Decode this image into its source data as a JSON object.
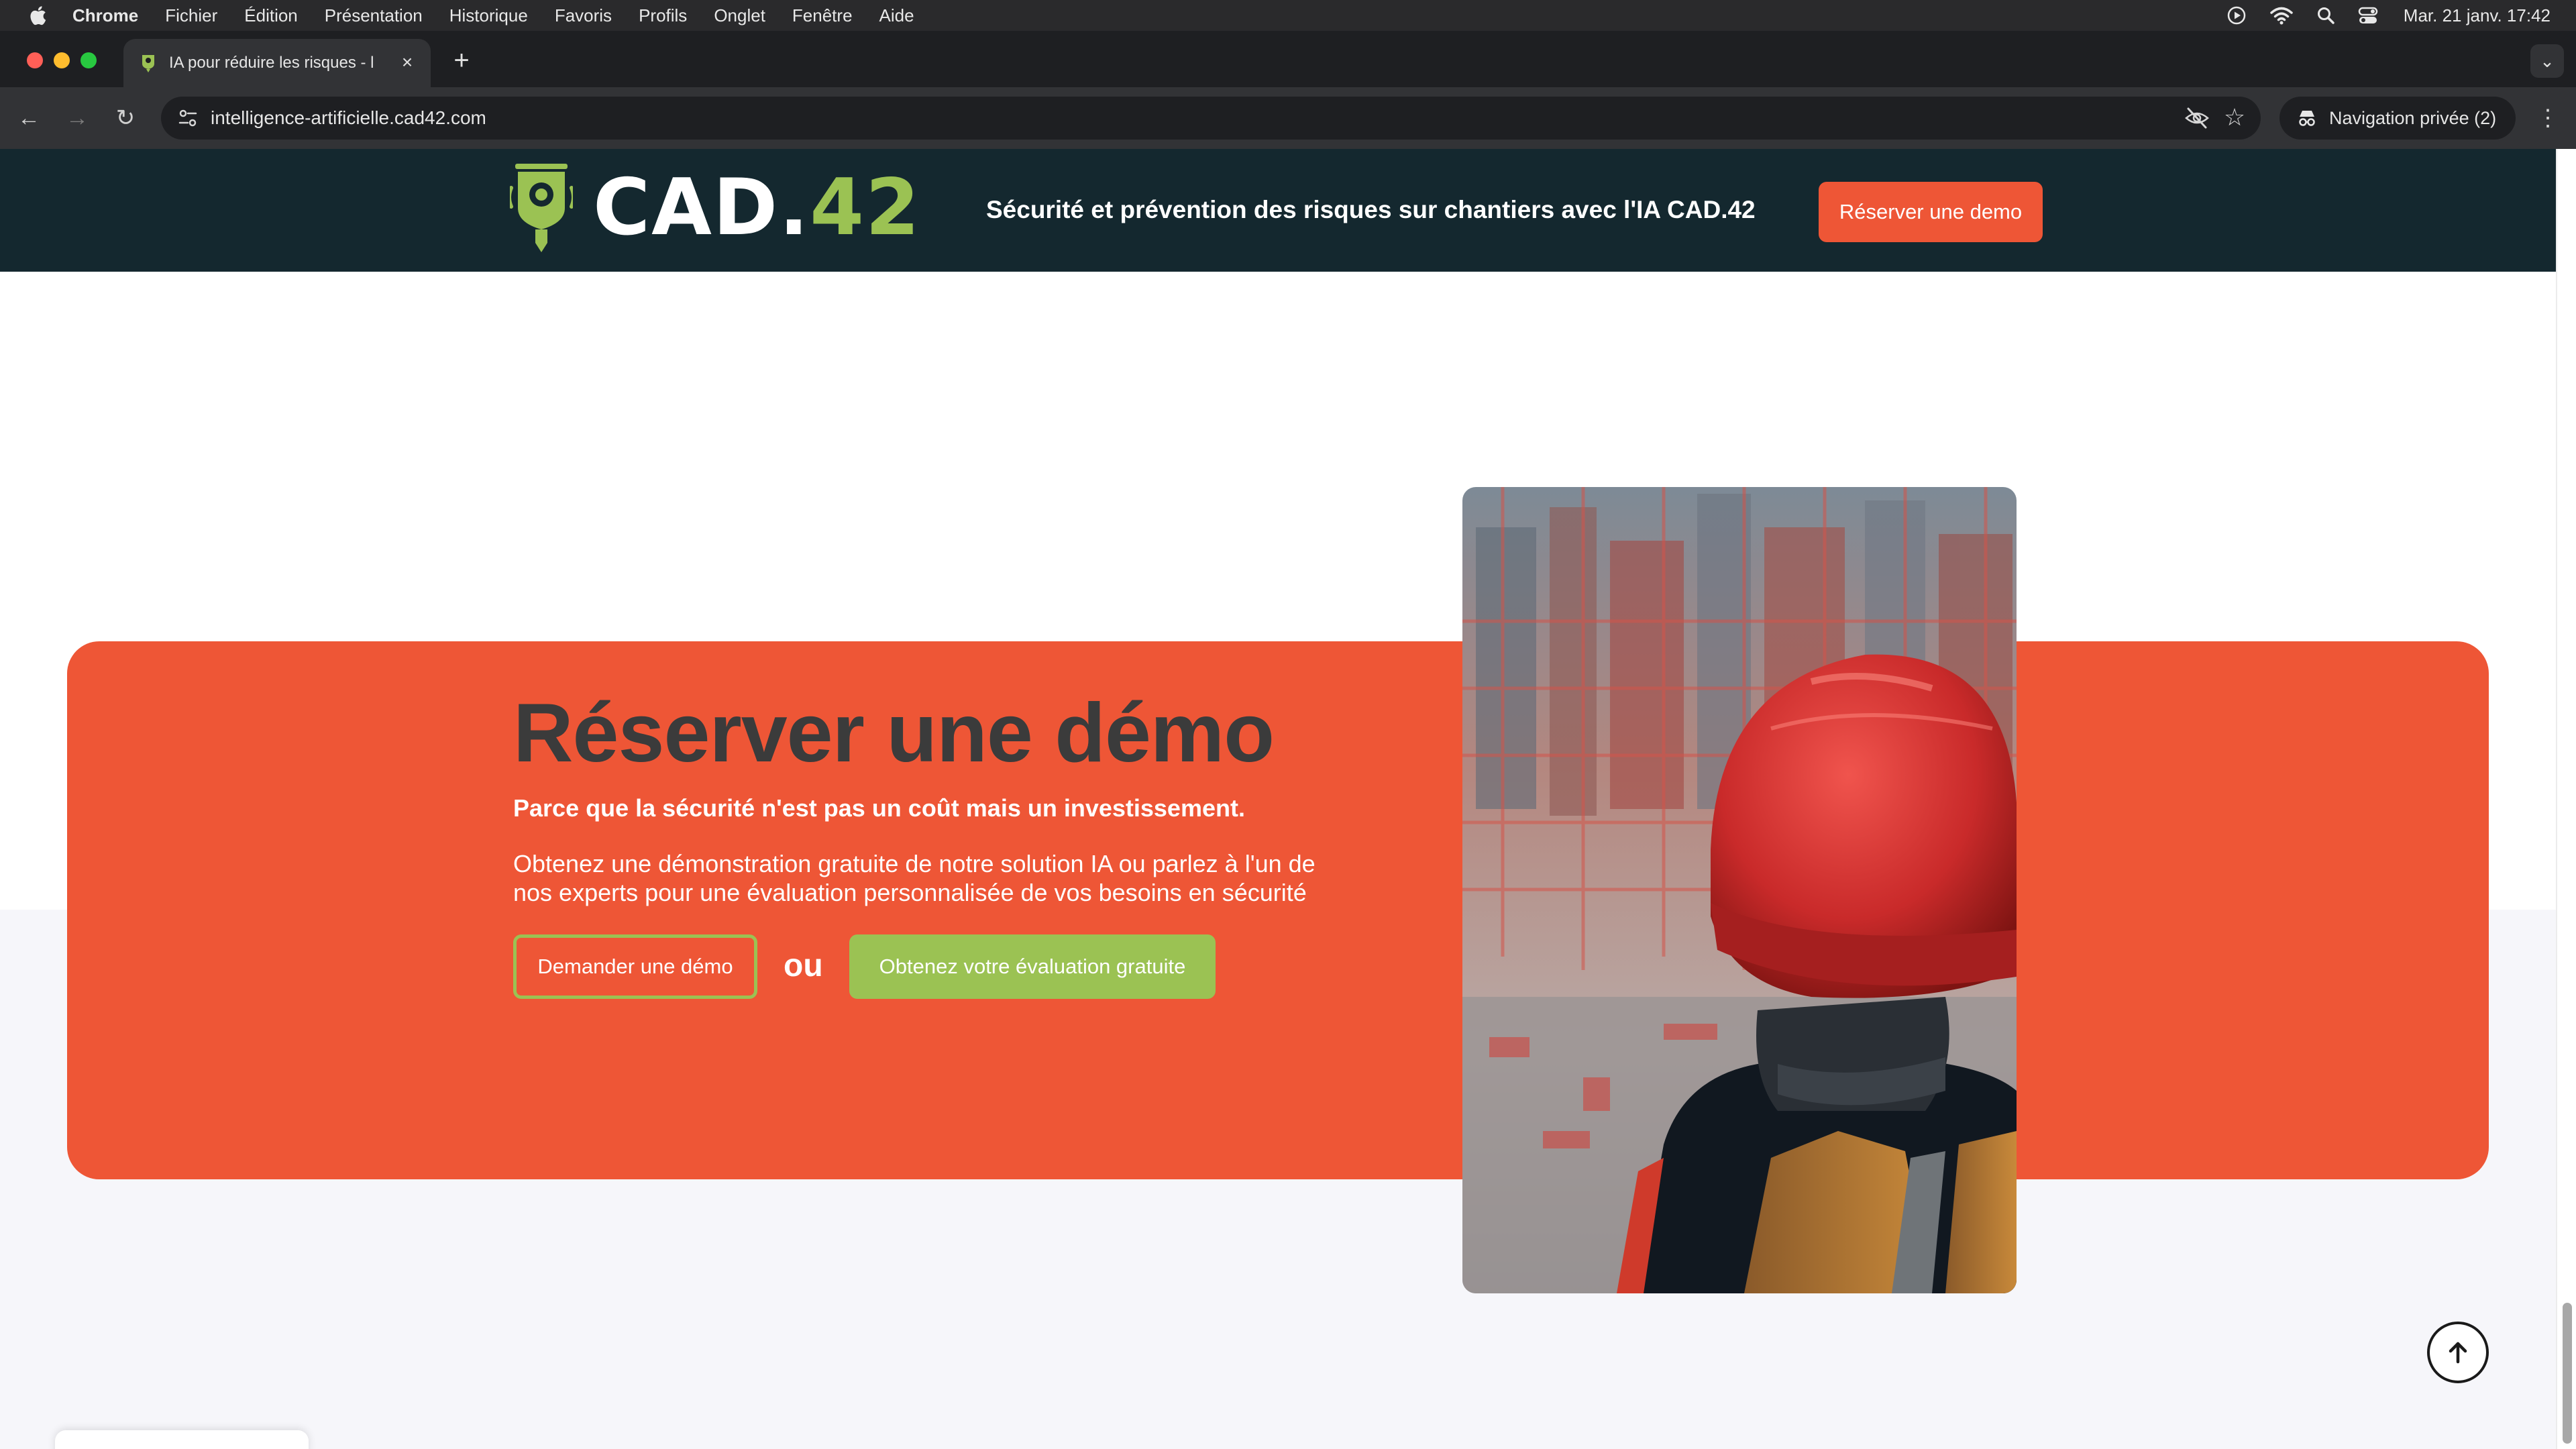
{
  "menubar": {
    "app": "Chrome",
    "items": [
      "Fichier",
      "Édition",
      "Présentation",
      "Historique",
      "Favoris",
      "Profils",
      "Onglet",
      "Fenêtre",
      "Aide"
    ],
    "datetime": "Mar. 21 janv.  17:42",
    "icons": [
      "apple-icon",
      "play-icon",
      "wifi-icon",
      "spotlight-search-icon",
      "control-center-icon"
    ]
  },
  "browser": {
    "tab_title": "IA pour réduire les risques - l",
    "url": "intelligence-artificielle.cad42.com",
    "incognito_label": "Navigation privée (2)"
  },
  "site_header": {
    "logo_cad": "CAD.",
    "logo_num": "42",
    "tagline": "Sécurité et prévention des risques sur chantiers avec l'IA CAD.42",
    "cta": "Réserver une demo"
  },
  "demo": {
    "title": "Réserver une démo",
    "subtitle": "Parce que la sécurité n'est pas un coût mais un investissement.",
    "description": "Obtenez une démonstration gratuite de notre solution IA ou parlez à l'un de nos experts pour une évaluation personnalisée de vos besoins en sécurité",
    "button_demo": "Demander une démo",
    "or": "ou",
    "button_eval": "Obtenez votre évaluation gratuite"
  },
  "colors": {
    "header_bg": "#14282f",
    "brand_orange": "#ee5636",
    "brand_green": "#9bc253",
    "title_dark": "#3b3b3b"
  }
}
